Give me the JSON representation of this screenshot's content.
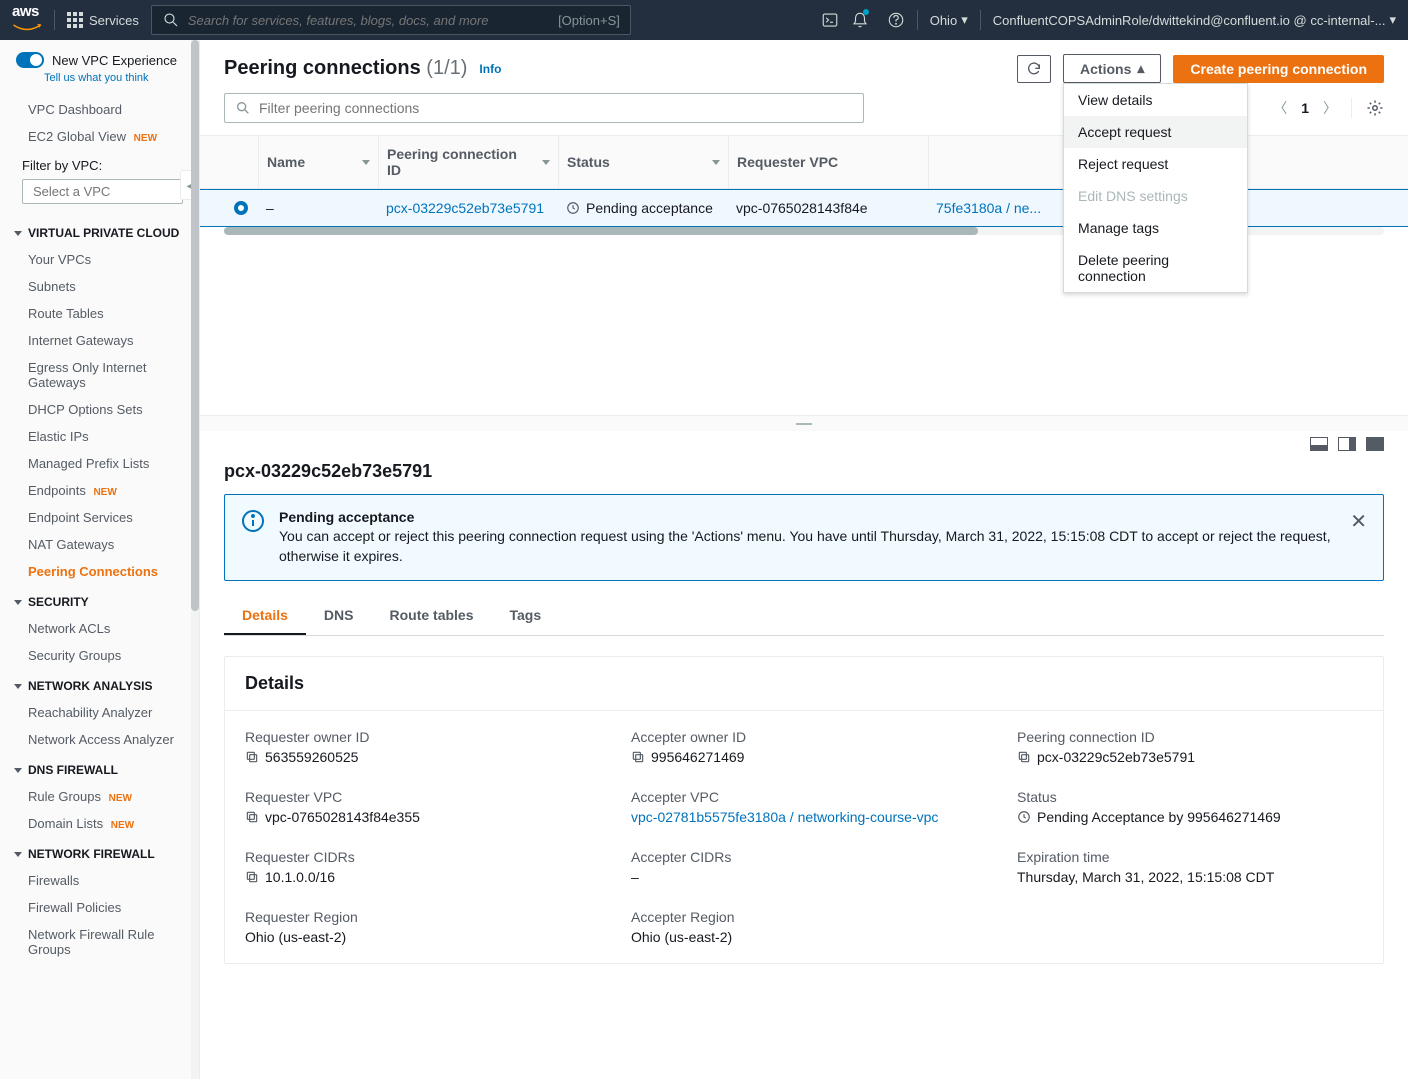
{
  "topbar": {
    "services": "Services",
    "search_placeholder": "Search for services, features, blogs, docs, and more",
    "shortcut": "[Option+S]",
    "region": "Ohio",
    "account": "ConfluentCOPSAdminRole/dwittekind@confluent.io @ cc-internal-..."
  },
  "sidebar": {
    "toggle_label": "New VPC Experience",
    "tellus": "Tell us what you think",
    "dashboard": "VPC Dashboard",
    "ec2global": "EC2 Global View",
    "filter_label": "Filter by VPC:",
    "filter_placeholder": "Select a VPC",
    "sections": {
      "vpc": "VIRTUAL PRIVATE CLOUD",
      "security": "SECURITY",
      "analysis": "NETWORK ANALYSIS",
      "dnsfw": "DNS FIREWALL",
      "netfw": "NETWORK FIREWALL"
    },
    "vpc_items": [
      "Your VPCs",
      "Subnets",
      "Route Tables",
      "Internet Gateways",
      "Egress Only Internet Gateways",
      "DHCP Options Sets",
      "Elastic IPs",
      "Managed Prefix Lists",
      "Endpoints",
      "Endpoint Services",
      "NAT Gateways",
      "Peering Connections"
    ],
    "security_items": [
      "Network ACLs",
      "Security Groups"
    ],
    "analysis_items": [
      "Reachability Analyzer",
      "Network Access Analyzer"
    ],
    "dnsfw_items": [
      "Rule Groups",
      "Domain Lists"
    ],
    "netfw_items": [
      "Firewalls",
      "Firewall Policies",
      "Network Firewall Rule Groups"
    ],
    "new": "New"
  },
  "header": {
    "title": "Peering connections",
    "count": "(1/1)",
    "info": "Info",
    "actions": "Actions",
    "create": "Create peering connection"
  },
  "actions_menu": [
    "View details",
    "Accept request",
    "Reject request",
    "Edit DNS settings",
    "Manage tags",
    "Delete peering connection"
  ],
  "filter": {
    "placeholder": "Filter peering connections"
  },
  "pagination": {
    "page": "1"
  },
  "table": {
    "cols": [
      "Name",
      "Peering connection ID",
      "Status",
      "Requester VPC"
    ],
    "row": {
      "name": "–",
      "pid": "pcx-03229c52eb73e5791",
      "status": "Pending acceptance",
      "reqvpc": "vpc-0765028143f84e",
      "accvpc": "75fe3180a / ne..."
    }
  },
  "detail": {
    "id": "pcx-03229c52eb73e5791",
    "alert_title": "Pending acceptance",
    "alert_body": "You can accept or reject this peering connection request using the 'Actions' menu. You have until Thursday, March 31, 2022, 15:15:08 CDT to accept or reject the request, otherwise it expires.",
    "tabs": [
      "Details",
      "DNS",
      "Route tables",
      "Tags"
    ],
    "card_title": "Details",
    "fields": {
      "req_owner_l": "Requester owner ID",
      "req_owner_v": "563559260525",
      "acc_owner_l": "Accepter owner ID",
      "acc_owner_v": "995646271469",
      "pcx_l": "Peering connection ID",
      "pcx_v": "pcx-03229c52eb73e5791",
      "req_vpc_l": "Requester VPC",
      "req_vpc_v": "vpc-0765028143f84e355",
      "acc_vpc_l": "Accepter VPC",
      "acc_vpc_v": "vpc-02781b5575fe3180a / networking-course-vpc",
      "status_l": "Status",
      "status_v": "Pending Acceptance by 995646271469",
      "req_cidr_l": "Requester CIDRs",
      "req_cidr_v": "10.1.0.0/16",
      "acc_cidr_l": "Accepter CIDRs",
      "acc_cidr_v": "–",
      "exp_l": "Expiration time",
      "exp_v": "Thursday, March 31, 2022, 15:15:08 CDT",
      "req_reg_l": "Requester Region",
      "req_reg_v": "Ohio (us-east-2)",
      "acc_reg_l": "Accepter Region",
      "acc_reg_v": "Ohio (us-east-2)"
    }
  }
}
